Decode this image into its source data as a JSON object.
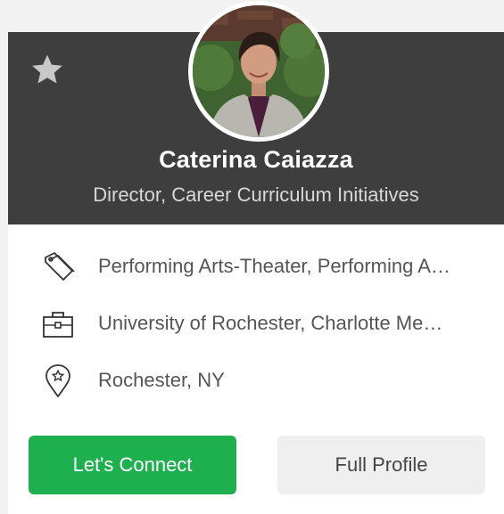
{
  "profile": {
    "name": "Caterina Caiazza",
    "title": "Director, Career Curriculum Initiatives",
    "favorited": false
  },
  "details": {
    "interests": "Performing Arts-Theater, Performing A…",
    "organization": "University of Rochester, Charlotte Me…",
    "location": "Rochester, NY"
  },
  "actions": {
    "connect_label": "Let's Connect",
    "profile_label": "Full Profile"
  },
  "icons": {
    "favorite": "star-icon",
    "interests": "tag-icon",
    "organization": "briefcase-icon",
    "location": "map-pin-icon"
  },
  "colors": {
    "header_bg": "#3e3e3e",
    "connect_button": "#1eaf4f",
    "profile_button": "#efefef",
    "star": "#c8c8c8"
  }
}
